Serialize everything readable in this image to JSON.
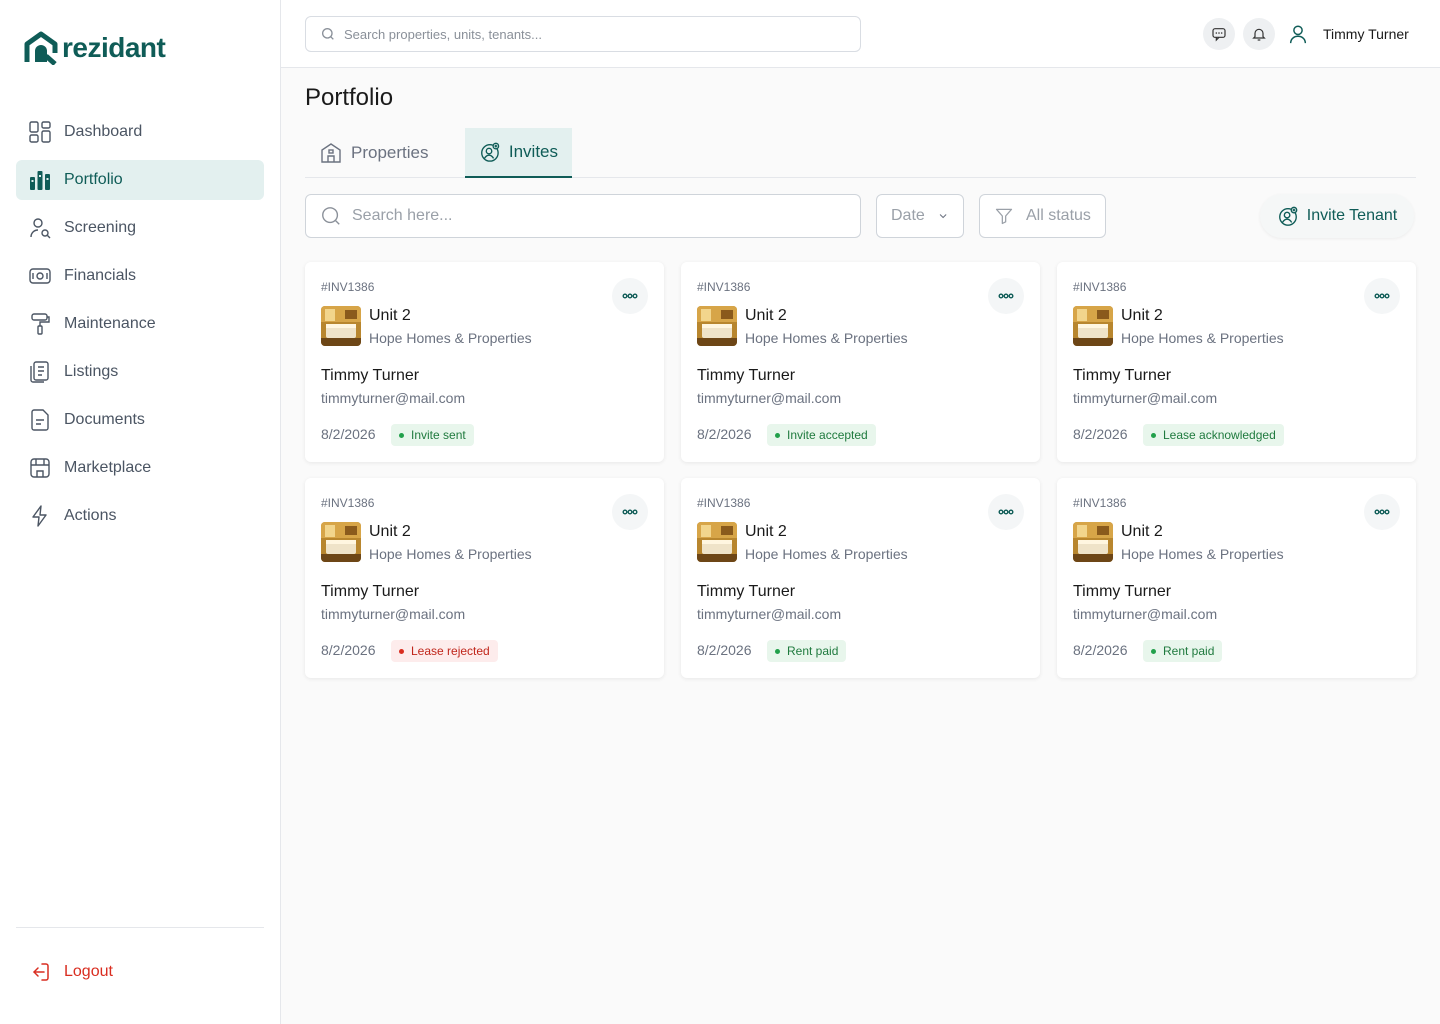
{
  "brand": {
    "name": "rezidant",
    "color": "#0f5c57"
  },
  "sidebar": {
    "items": [
      {
        "label": "Dashboard",
        "icon": "grid-icon"
      },
      {
        "label": "Portfolio",
        "icon": "building-chart-icon",
        "active": true
      },
      {
        "label": "Screening",
        "icon": "user-search-icon"
      },
      {
        "label": "Financials",
        "icon": "money-icon"
      },
      {
        "label": "Maintenance",
        "icon": "paint-roller-icon"
      },
      {
        "label": "Listings",
        "icon": "list-doc-icon"
      },
      {
        "label": "Documents",
        "icon": "document-icon"
      },
      {
        "label": "Marketplace",
        "icon": "store-icon"
      },
      {
        "label": "Actions",
        "icon": "lightning-icon"
      }
    ],
    "logout_label": "Logout"
  },
  "topbar": {
    "search_placeholder": "Search properties, units, tenants...",
    "user_name": "Timmy Turner"
  },
  "page": {
    "title": "Portfolio",
    "tabs": [
      {
        "label": "Properties",
        "icon": "house-icon"
      },
      {
        "label": "Invites",
        "icon": "user-add-icon",
        "active": true
      }
    ]
  },
  "filters": {
    "search_placeholder": "Search here...",
    "date_label": "Date",
    "status_label": "All status",
    "invite_button": "Invite Tenant"
  },
  "invites": [
    {
      "id": "#INV1386",
      "unit": "Unit 2",
      "company": "Hope Homes & Properties",
      "tenant": "Timmy Turner",
      "email": "timmyturner@mail.com",
      "date": "8/2/2026",
      "status": "Invite sent",
      "status_color": "green"
    },
    {
      "id": "#INV1386",
      "unit": "Unit 2",
      "company": "Hope Homes & Properties",
      "tenant": "Timmy Turner",
      "email": "timmyturner@mail.com",
      "date": "8/2/2026",
      "status": "Invite accepted",
      "status_color": "green"
    },
    {
      "id": "#INV1386",
      "unit": "Unit 2",
      "company": "Hope Homes & Properties",
      "tenant": "Timmy Turner",
      "email": "timmyturner@mail.com",
      "date": "8/2/2026",
      "status": "Lease acknowledged",
      "status_color": "green"
    },
    {
      "id": "#INV1386",
      "unit": "Unit 2",
      "company": "Hope Homes & Properties",
      "tenant": "Timmy Turner",
      "email": "timmyturner@mail.com",
      "date": "8/2/2026",
      "status": "Lease rejected",
      "status_color": "red"
    },
    {
      "id": "#INV1386",
      "unit": "Unit 2",
      "company": "Hope Homes & Properties",
      "tenant": "Timmy Turner",
      "email": "timmyturner@mail.com",
      "date": "8/2/2026",
      "status": "Rent paid",
      "status_color": "green"
    },
    {
      "id": "#INV1386",
      "unit": "Unit 2",
      "company": "Hope Homes & Properties",
      "tenant": "Timmy Turner",
      "email": "timmyturner@mail.com",
      "date": "8/2/2026",
      "status": "Rent paid",
      "status_color": "green"
    }
  ]
}
